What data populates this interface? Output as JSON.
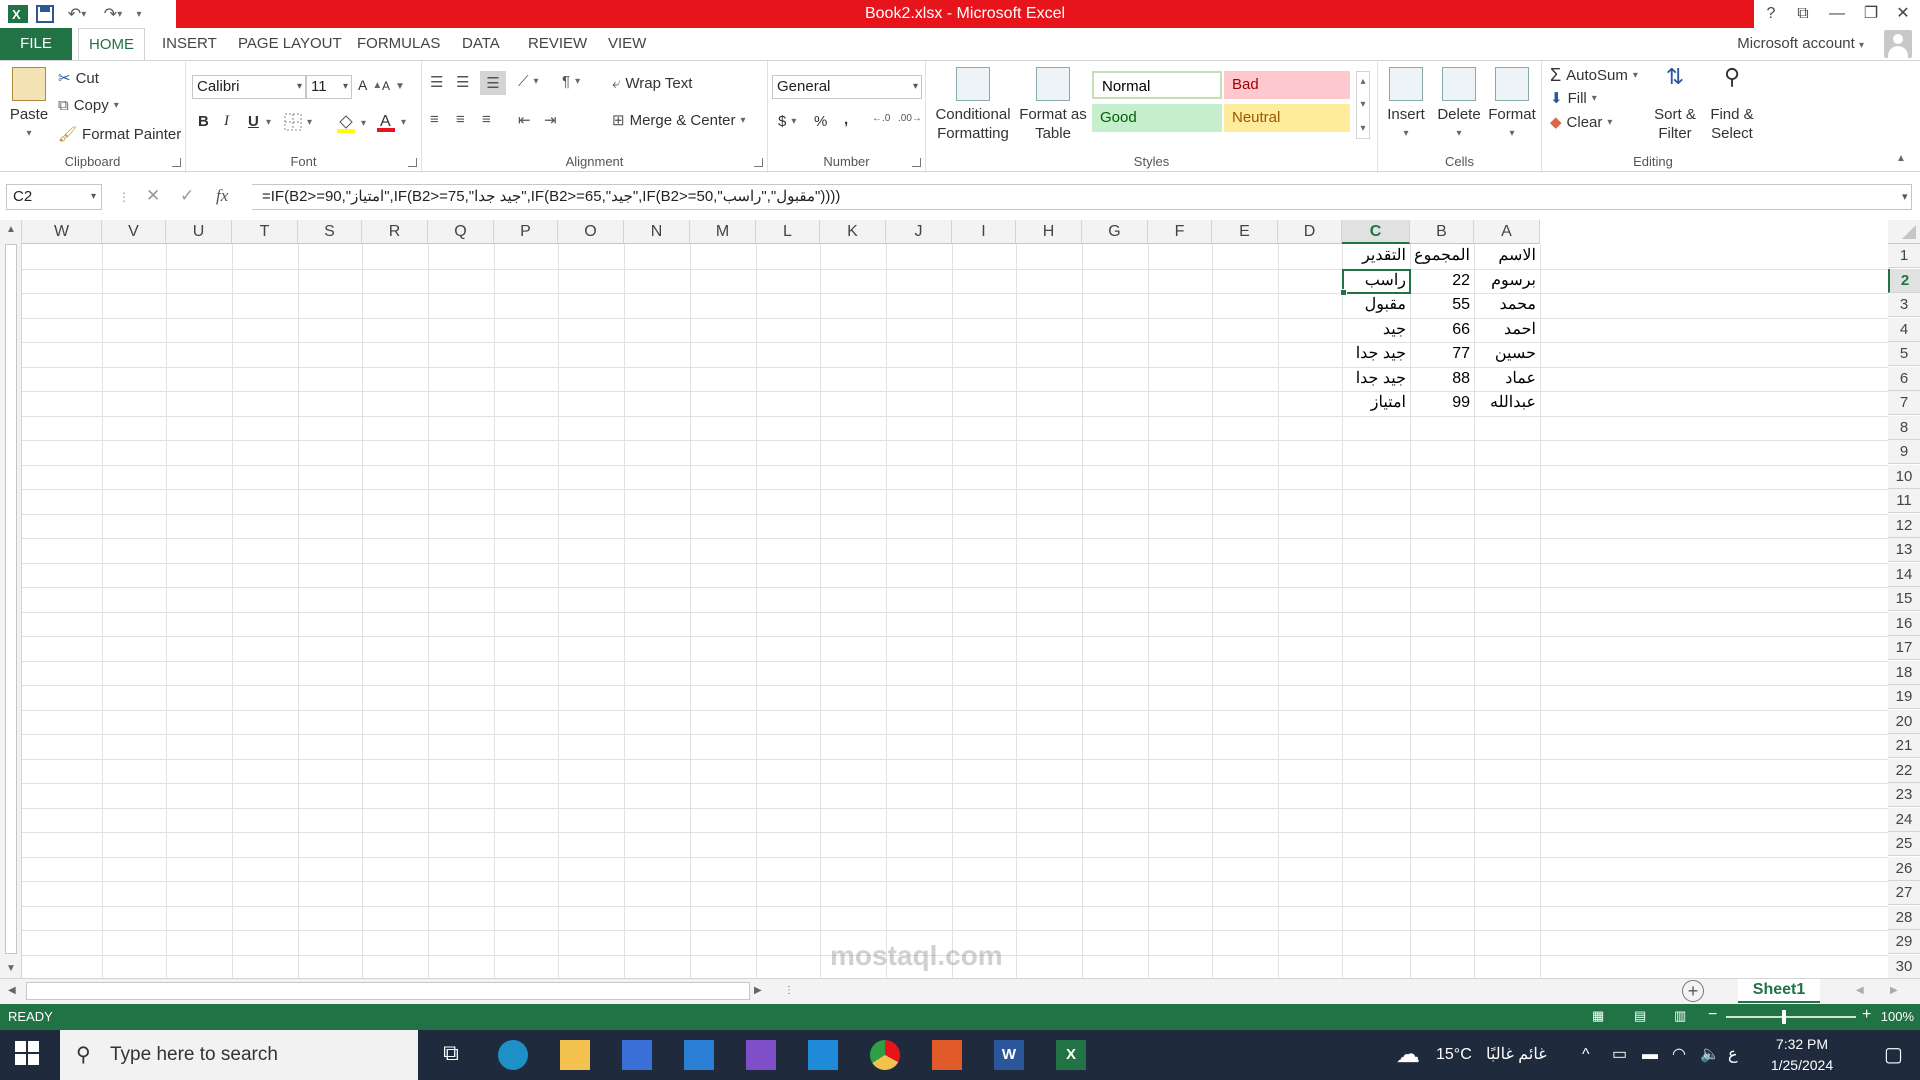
{
  "window": {
    "title": "Book2.xlsx -  Microsoft Excel",
    "help": "?",
    "account": "Microsoft account"
  },
  "tabs": [
    "FILE",
    "HOME",
    "INSERT",
    "PAGE LAYOUT",
    "FORMULAS",
    "DATA",
    "REVIEW",
    "VIEW"
  ],
  "active_tab": "HOME",
  "ribbon": {
    "clipboard": {
      "paste": "Paste",
      "cut": "Cut",
      "copy": "Copy",
      "format_painter": "Format Painter",
      "label": "Clipboard"
    },
    "font": {
      "name": "Calibri",
      "size": "11",
      "bold": "B",
      "italic": "I",
      "underline": "U",
      "label": "Font"
    },
    "alignment": {
      "wrap_text": "Wrap Text",
      "merge_center": "Merge & Center",
      "label": "Alignment"
    },
    "number": {
      "format": "General",
      "currency": "$",
      "percent": "%",
      "comma": ",",
      "label": "Number"
    },
    "styles": {
      "conditional": [
        "Conditional",
        "Formatting"
      ],
      "format_table": [
        "Format as",
        "Table"
      ],
      "normal": "Normal",
      "bad": "Bad",
      "good": "Good",
      "neutral": "Neutral",
      "label": "Styles"
    },
    "cells": {
      "insert": "Insert",
      "delete": "Delete",
      "format": "Format",
      "label": "Cells"
    },
    "editing": {
      "autosum": "AutoSum",
      "fill": "Fill",
      "clear": "Clear",
      "sort": [
        "Sort &",
        "Filter"
      ],
      "find": [
        "Find &",
        "Select"
      ],
      "label": "Editing"
    }
  },
  "formula_bar": {
    "name_box": "C2",
    "fx": "fx",
    "formula": "=IF(B2>=90,\"امتياز\",IF(B2>=75,\"جيد جدا\",IF(B2>=65,\"جيد\",IF(B2>=50,\"مقبول\",\"راسب\"))))"
  },
  "columns": [
    "W",
    "V",
    "U",
    "T",
    "S",
    "R",
    "Q",
    "P",
    "O",
    "N",
    "M",
    "L",
    "K",
    "J",
    "I",
    "H",
    "G",
    "F",
    "E",
    "D",
    "C",
    "B",
    "A"
  ],
  "selected_column": "C",
  "rows": [
    "1",
    "2",
    "3",
    "4",
    "5",
    "6",
    "7",
    "8",
    "9",
    "10",
    "11",
    "12",
    "13",
    "14",
    "15",
    "16",
    "17",
    "18",
    "19",
    "20",
    "21",
    "22",
    "23",
    "24",
    "25",
    "26",
    "27",
    "28",
    "29",
    "30"
  ],
  "selected_row": "2",
  "sheet_rows": [
    {
      "a": "الاسم",
      "b": "المجموع",
      "c": "التقدير"
    },
    {
      "a": "برسوم",
      "b": "22",
      "c": "راسب"
    },
    {
      "a": "محمد",
      "b": "55",
      "c": "مقبول"
    },
    {
      "a": "احمد",
      "b": "66",
      "c": "جيد"
    },
    {
      "a": "حسين",
      "b": "77",
      "c": "جيد جدا"
    },
    {
      "a": "عماد",
      "b": "88",
      "c": "جيد جدا"
    },
    {
      "a": "عبدالله",
      "b": "99",
      "c": "امتياز"
    }
  ],
  "sheet_tab": "Sheet1",
  "status": {
    "ready": "READY",
    "zoom": "100%"
  },
  "taskbar": {
    "search_placeholder": "Type here to search",
    "weather_temp": "15°C",
    "weather_text": "غائم غالبًا",
    "lang": "ع",
    "time": "7:32 PM",
    "date": "1/25/2024"
  },
  "colors": {
    "excel_green": "#217346",
    "title_red": "#e8141c",
    "taskbar": "#1f2b3c"
  }
}
